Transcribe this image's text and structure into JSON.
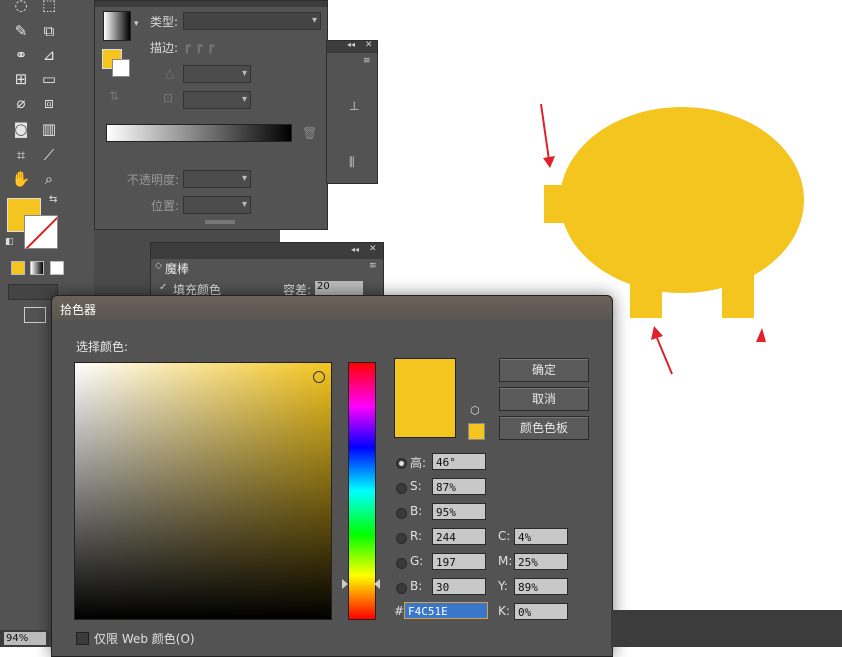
{
  "gradient_panel": {
    "type_label": "类型:",
    "stroke_label": "描边:",
    "opacity_label": "不透明度:",
    "position_label": "位置:"
  },
  "magic_wand": {
    "title": "魔棒",
    "fill_color_label": "填充颜色",
    "tolerance_label": "容差:",
    "tolerance_value": "20"
  },
  "color_picker": {
    "title": "拾色器",
    "choose_label": "选择颜色:",
    "buttons": {
      "ok": "确定",
      "cancel": "取消",
      "swatches": "颜色色板"
    },
    "hsb": {
      "h_label": "高:",
      "h_value": "46°",
      "s_label": "S:",
      "s_value": "87%",
      "b_label": "B:",
      "b_value": "95%"
    },
    "rgb": {
      "r_label": "R:",
      "r_value": "244",
      "g_label": "G:",
      "g_value": "197",
      "b_label": "B:",
      "b_value": "30"
    },
    "cmyk": {
      "c_label": "C:",
      "c_value": "4%",
      "m_label": "M:",
      "m_value": "25%",
      "y_label": "Y:",
      "y_value": "89%",
      "k_label": "K:",
      "k_value": "0%"
    },
    "hex_label": "#",
    "hex_value": "F4C51E",
    "web_only_label": "仅限 Web 颜色(O)"
  },
  "status": {
    "zoom": "94%"
  },
  "colors": {
    "fill": "#f4c51e",
    "arrow": "#e0202a",
    "panel": "#535353",
    "dark": "#3c3c3c"
  }
}
